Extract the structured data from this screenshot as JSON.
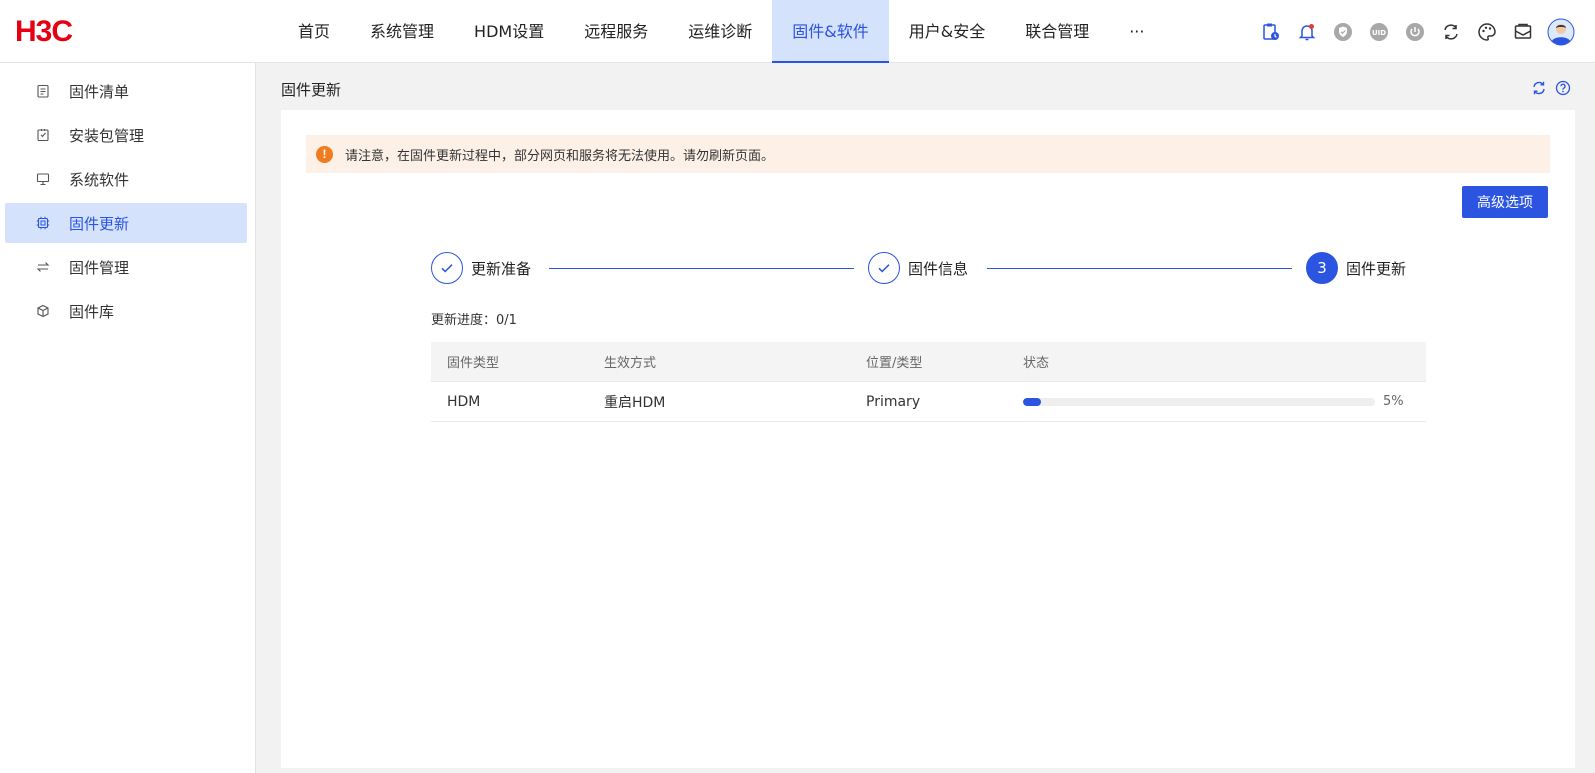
{
  "brand": {
    "logo_text": "H3C",
    "logo_color": "#e60012"
  },
  "nav": {
    "items": [
      {
        "label": "首页"
      },
      {
        "label": "系统管理"
      },
      {
        "label": "HDM设置"
      },
      {
        "label": "远程服务"
      },
      {
        "label": "运维诊断"
      },
      {
        "label": "固件&软件",
        "active": true
      },
      {
        "label": "用户&安全"
      },
      {
        "label": "联合管理"
      },
      {
        "label": "···"
      }
    ],
    "icons": [
      "clipboard-clock-icon",
      "bell-icon",
      "shield-icon",
      "uid-icon",
      "power-icon",
      "refresh-cycle-icon",
      "palette-icon",
      "mail-icon",
      "avatar"
    ],
    "uid_text": "UID"
  },
  "sidebar": {
    "items": [
      {
        "label": "固件清单",
        "icon": "list-icon"
      },
      {
        "label": "安装包管理",
        "icon": "package-icon"
      },
      {
        "label": "系统软件",
        "icon": "monitor-icon"
      },
      {
        "label": "固件更新",
        "icon": "chip-icon",
        "active": true
      },
      {
        "label": "固件管理",
        "icon": "swap-icon"
      },
      {
        "label": "固件库",
        "icon": "cube-icon"
      }
    ]
  },
  "content": {
    "title": "固件更新",
    "alert": {
      "icon_text": "!",
      "text": "请注意，在固件更新过程中，部分网页和服务将无法使用。请勿刷新页面。"
    },
    "advanced_button": "高级选项",
    "steps": [
      {
        "label": "更新准备",
        "state": "done"
      },
      {
        "label": "固件信息",
        "state": "done"
      },
      {
        "label": "固件更新",
        "state": "current",
        "number": "3"
      }
    ],
    "progress_label": "更新进度：0/1",
    "table": {
      "headers": [
        "固件类型",
        "生效方式",
        "位置/类型",
        "状态"
      ],
      "rows": [
        {
          "type": "HDM",
          "method": "重启HDM",
          "location": "Primary",
          "progress": 5,
          "progress_text": "5%"
        }
      ]
    }
  },
  "colors": {
    "accent": "#2b54e0",
    "active_bg": "#d4e2fb",
    "warning": "#f07c1e",
    "alert_bg": "#fdf0e7"
  }
}
